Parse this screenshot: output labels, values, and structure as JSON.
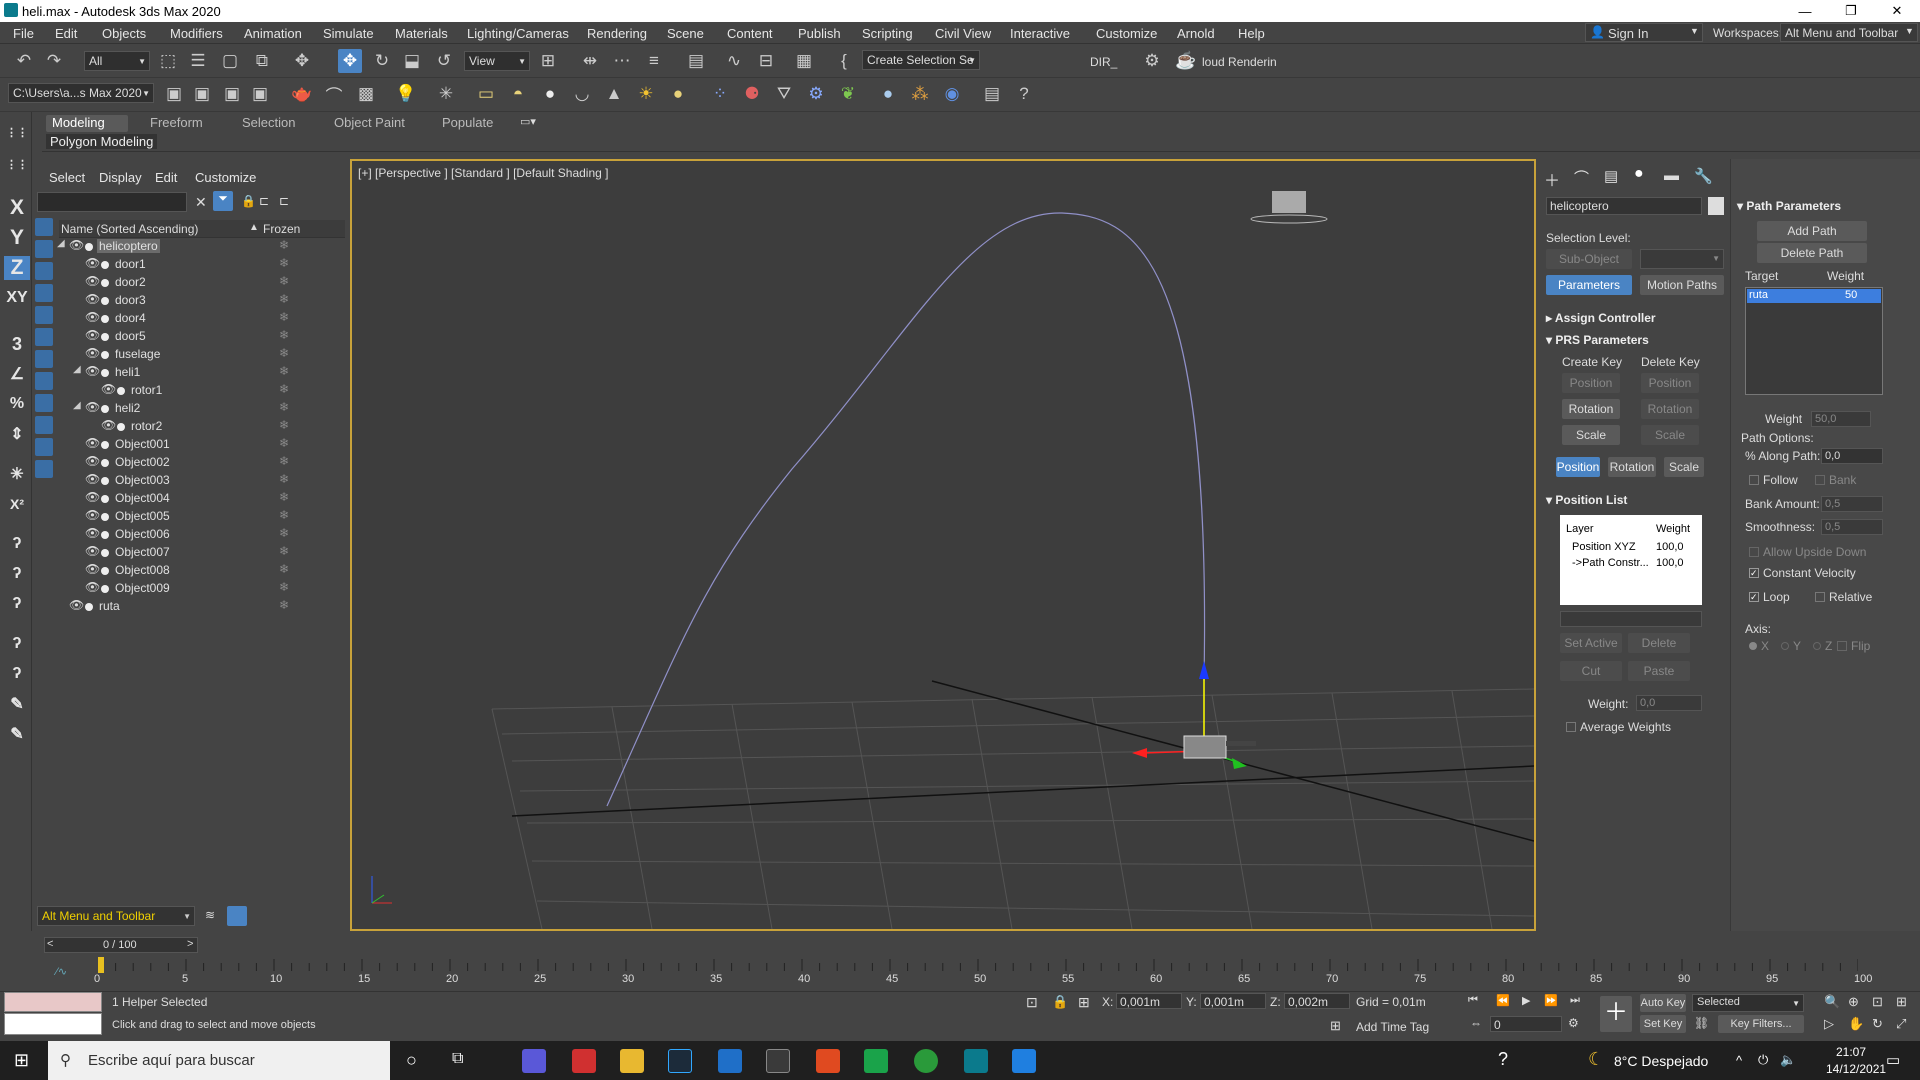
{
  "window": {
    "title": "heli.max - Autodesk 3ds Max 2020",
    "minimize": "—",
    "maximize": "❐",
    "close": "✕"
  },
  "menu": [
    "File",
    "Edit",
    "Objects",
    "Modifiers",
    "Animation",
    "Simulate",
    "Materials",
    "Lighting/Cameras",
    "Rendering",
    "Scene",
    "Content",
    "Publish",
    "Scripting",
    "Civil View",
    "Interactive",
    "Customize",
    "Arnold",
    "Help"
  ],
  "account": {
    "sign_in": "Sign In",
    "workspaces_label": "Workspaces:",
    "workspace": "Alt Menu and Toolbar"
  },
  "toolbar1": {
    "filter": "All",
    "view": "View",
    "create_selection": "Create Selection Se",
    "dir": "DIR_",
    "cloud": "loud Renderin"
  },
  "toolbar2": {
    "path": "C:\\Users\\a...s Max 2020"
  },
  "ribbon": {
    "tabs": [
      "Modeling",
      "Freeform",
      "Selection",
      "Object Paint",
      "Populate"
    ],
    "panel": "Polygon Modeling"
  },
  "left_axes": [
    "X",
    "Y",
    "Z",
    "XY"
  ],
  "scene_explorer": {
    "tabs": [
      "Select",
      "Display",
      "Edit",
      "Customize"
    ],
    "col_name": "Name (Sorted Ascending)",
    "col_sort": "▲",
    "col_frozen": "Frozen",
    "rows": [
      {
        "name": "helicoptero",
        "level": 0,
        "expand": "◢",
        "selected": true
      },
      {
        "name": "door1",
        "level": 1
      },
      {
        "name": "door2",
        "level": 1
      },
      {
        "name": "door3",
        "level": 1
      },
      {
        "name": "door4",
        "level": 1
      },
      {
        "name": "door5",
        "level": 1
      },
      {
        "name": "fuselage",
        "level": 1
      },
      {
        "name": "heli1",
        "level": 1,
        "expand": "◢"
      },
      {
        "name": "rotor1",
        "level": 2
      },
      {
        "name": "heli2",
        "level": 1,
        "expand": "◢"
      },
      {
        "name": "rotor2",
        "level": 2
      },
      {
        "name": "Object001",
        "level": 1
      },
      {
        "name": "Object002",
        "level": 1
      },
      {
        "name": "Object003",
        "level": 1
      },
      {
        "name": "Object004",
        "level": 1
      },
      {
        "name": "Object005",
        "level": 1
      },
      {
        "name": "Object006",
        "level": 1
      },
      {
        "name": "Object007",
        "level": 1
      },
      {
        "name": "Object008",
        "level": 1
      },
      {
        "name": "Object009",
        "level": 1
      },
      {
        "name": "ruta",
        "level": 0
      }
    ],
    "bottom_workspace": "Alt Menu and Toolbar"
  },
  "viewport": {
    "label": "[+] [Perspective ] [Standard ] [Default Shading ]"
  },
  "command_panel": {
    "object_name": "helicoptero",
    "selection_level": "Selection Level:",
    "sub_object": "Sub-Object",
    "parameters": "Parameters",
    "motion_paths": "Motion Paths",
    "assign_controller": "Assign Controller",
    "prs_parameters": "PRS Parameters",
    "create_key": "Create Key",
    "delete_key": "Delete Key",
    "position": "Position",
    "rotation": "Rotation",
    "scale": "Scale",
    "position_list": "Position List",
    "pl_layer": "Layer",
    "pl_weight": "Weight",
    "pl_rows": [
      {
        "name": "Position XYZ",
        "w": "100,0"
      },
      {
        "name": "->Path Constr...",
        "w": "100,0"
      }
    ],
    "set_active": "Set Active",
    "delete": "Delete",
    "cut": "Cut",
    "paste": "Paste",
    "weight_label": "Weight:",
    "weight_val": "0,0",
    "average_weights": "Average Weights"
  },
  "path_params": {
    "title": "Path Parameters",
    "add_path": "Add Path",
    "delete_path": "Delete Path",
    "target": "Target",
    "weight": "Weight",
    "target_name": "ruta",
    "target_weight": "50",
    "weight_label": "Weight",
    "weight_val": "50,0",
    "path_options": "Path Options:",
    "along_path": "% Along Path:",
    "along_val": "0,0",
    "follow": "Follow",
    "bank": "Bank",
    "bank_amount": "Bank Amount:",
    "bank_val": "0,5",
    "smoothness": "Smoothness:",
    "smooth_val": "0,5",
    "allow_upside": "Allow Upside Down",
    "constant_velocity": "Constant Velocity",
    "loop": "Loop",
    "relative": "Relative",
    "axis": "Axis:",
    "ax": [
      "X",
      "Y",
      "Z"
    ],
    "flip": "Flip"
  },
  "timeline": {
    "frame": "0 / 100",
    "ticks": [
      "0",
      "5",
      "10",
      "15",
      "20",
      "25",
      "30",
      "35",
      "40",
      "45",
      "50",
      "55",
      "60",
      "65",
      "70",
      "75",
      "80",
      "85",
      "90",
      "95",
      "100"
    ]
  },
  "status": {
    "selected": "1 Helper Selected",
    "prompt": "Click and drag to select and move objects",
    "x_label": "X:",
    "x": "0,001m",
    "y_label": "Y:",
    "y": "0,001m",
    "z_label": "Z:",
    "z": "0,002m",
    "grid": "Grid = 0,01m",
    "add_time_tag": "Add Time Tag",
    "auto_key": "Auto Key",
    "set_key": "Set Key",
    "key_mode": "Selected",
    "key_filters": "Key Filters...",
    "frame": "0"
  },
  "taskbar": {
    "search": "Escribe aquí para buscar",
    "weather": "8°C  Despejado",
    "time": "21:07",
    "date": "14/12/2021"
  }
}
